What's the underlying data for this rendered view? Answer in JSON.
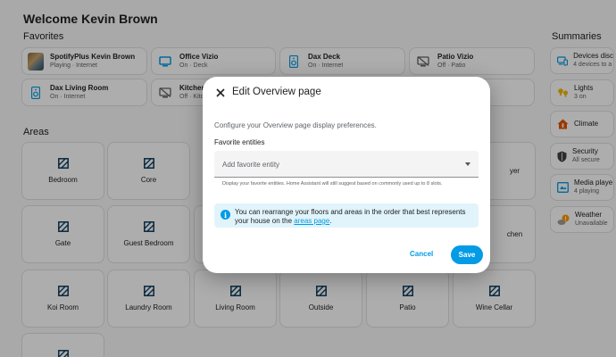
{
  "header": {
    "title": "Welcome Kevin Brown"
  },
  "sections": {
    "favorites": "Favorites",
    "areas": "Areas",
    "summaries": "Summaries"
  },
  "favorites": [
    {
      "name": "SpotifyPlus Kevin Brown",
      "state": "Playing · Internet",
      "icon": "album-art"
    },
    {
      "name": "Office Vizio",
      "state": "On · Deck",
      "icon": "tv-icon"
    },
    {
      "name": "Dax Deck",
      "state": "On · Internet",
      "icon": "speaker-icon"
    },
    {
      "name": "Patio Vizio",
      "state": "Off · Patio",
      "icon": "tv-off-icon"
    },
    {
      "name": "Dax Living Room",
      "state": "On · Internet",
      "icon": "speaker-icon"
    },
    {
      "name": "Kitchen",
      "state": "Off · Kitc",
      "icon": "tv-off-icon"
    }
  ],
  "areas": [
    "Bedroom",
    "Core",
    "Gate",
    "Guest Bedroom",
    "Koi Room",
    "Laundry Room",
    "Living Room",
    "Outside",
    "Patio",
    "Wine Cellar",
    "yer",
    "chen"
  ],
  "summaries": [
    {
      "name": "Devices disc",
      "state": "4 devices to a",
      "icon": "devices-icon"
    },
    {
      "name": "Lights",
      "state": "3 on",
      "icon": "lightbulb-icon"
    },
    {
      "name": "Climate",
      "state": "",
      "icon": "home-climate-icon"
    },
    {
      "name": "Security",
      "state": "All secure",
      "icon": "shield-icon"
    },
    {
      "name": "Media playe",
      "state": "4 playing",
      "icon": "media-icon"
    },
    {
      "name": "Weather",
      "state": "Unavailable",
      "icon": "weather-icon"
    }
  ],
  "dialog": {
    "title": "Edit Overview page",
    "description": "Configure your Overview page display preferences.",
    "field_label": "Favorite entities",
    "field_placeholder": "Add favorite entity",
    "helper": "Display your favorite entities. Home Assistant will still suggest based on commonly used up to 8 slots.",
    "info_text": "You can rearrange your floors and areas in the order that best represents your house on the ",
    "info_link": "areas page",
    "info_end": ".",
    "cancel_label": "Cancel",
    "save_label": "Save"
  },
  "colors": {
    "accent": "#039be5",
    "info_bg": "#e1f4fb",
    "warning": "#ff9800"
  }
}
